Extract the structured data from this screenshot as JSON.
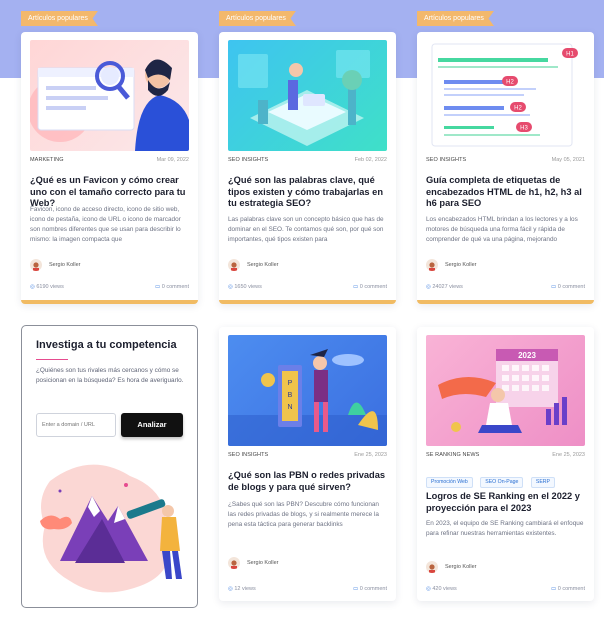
{
  "cards": [
    {
      "ribbon": "Artículos populares",
      "category": "MARKETING",
      "date": "Mar 09, 2022",
      "title": "¿Qué es un Favicon y cómo crear uno con el tamaño correcto para tu Web?",
      "excerpt": "Favicon, icono de acceso directo, icono de sitio web, icono de pestaña, icono de URL o icono de marcador son nombres diferentes que se usan para describir lo mismo: la imagen compacta que",
      "author": "Sergio Koller",
      "views": "6190 views",
      "comments": "0 comment"
    },
    {
      "ribbon": "Artículos populares",
      "category": "SEO INSIGHTS",
      "date": "Feb 02, 2022",
      "title": "¿Qué son las palabras clave, qué tipos existen y cómo trabajarlas en tu estrategia SEO?",
      "excerpt": "Las palabras clave son un concepto básico que has de dominar en el SEO. Te contamos qué son, por qué son importantes, qué tipos existen para",
      "author": "Sergio Koller",
      "views": "1650 views",
      "comments": "0 comment"
    },
    {
      "ribbon": "Artículos populares",
      "category": "SEO INSIGHTS",
      "date": "May 05, 2021",
      "title": "Guía completa de etiquetas de encabezados HTML de h1, h2, h3 al h6 para SEO",
      "excerpt": "Los encabezados HTML brindan a los lectores y a los motores de búsqueda una forma fácil y rápida de comprender de qué va una página, mejorando",
      "author": "Sergio Koller",
      "views": "24027 views",
      "comments": "0 comment",
      "thumb_tags": [
        "H1",
        "H2",
        "H2",
        "H3"
      ]
    },
    {
      "category": "SEO INSIGHTS",
      "date": "Ene 25, 2023",
      "title": "¿Qué son las PBN o redes privadas de blogs y para qué sirven?",
      "excerpt": "¿Sabes qué son las PBN? Descubre cómo funcionan las redes privadas de blogs, y si realmente merece la pena esta táctica para generar backlinks",
      "author": "Sergio Koller",
      "views": "12 views",
      "comments": "0 comment"
    },
    {
      "category": "SE RANKING NEWS",
      "date": "Ene 25, 2023",
      "tags": [
        "Promoción Web",
        "SEO On-Page",
        "SERP"
      ],
      "title": "Logros de SE Ranking en el 2022 y proyección para el 2023",
      "excerpt": "En 2023, el equipo de SE Ranking cambiará el enfoque para refinar nuestras herramientas existentes.",
      "author": "Sergio Koller",
      "views": "420 views",
      "comments": "0 comment",
      "thumb_year": "2023"
    }
  ],
  "promo": {
    "title": "Investiga a tu competencia",
    "text": "¿Quiénes son tus rivales más cercanos y cómo se posicionan en la búsqueda? Es hora de averiguarlo.",
    "input_placeholder": "Enter a domain / URL",
    "button_label": "Analizar"
  },
  "colors": {
    "band": "#a4b1f1",
    "ribbon": "#f3b86c",
    "card_bottom_border": "#f1bb63",
    "accent_blue": "#3f7fe0",
    "promo_underline": "#e64b8f"
  }
}
